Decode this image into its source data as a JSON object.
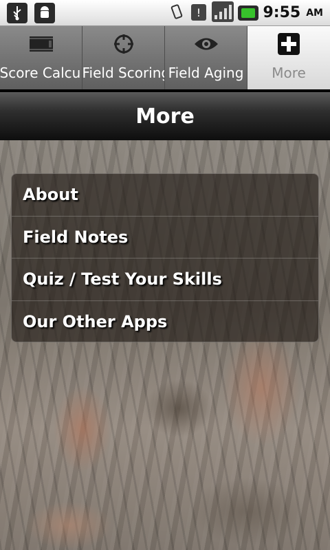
{
  "status_bar": {
    "left_icons": [
      "usb-icon",
      "android-debug-icon"
    ],
    "right_icons": [
      "vibrate-icon",
      "sim-alert-icon",
      "signal-icon",
      "battery-charging-icon"
    ],
    "time": "9:55",
    "ampm": "AM",
    "battery_color": "#37c22b"
  },
  "tabs": [
    {
      "label": "Score Calculator",
      "icon": "film-strip-icon",
      "active": false
    },
    {
      "label": "Field Scoring",
      "icon": "crosshair-icon",
      "active": false
    },
    {
      "label": "Field Aging",
      "icon": "eye-icon",
      "active": false
    },
    {
      "label": "More",
      "icon": "plus-icon",
      "active": true
    }
  ],
  "title": "More",
  "menu": [
    {
      "label": "About"
    },
    {
      "label": "Field Notes"
    },
    {
      "label": "Quiz / Test Your Skills"
    },
    {
      "label": "Our Other Apps"
    }
  ]
}
